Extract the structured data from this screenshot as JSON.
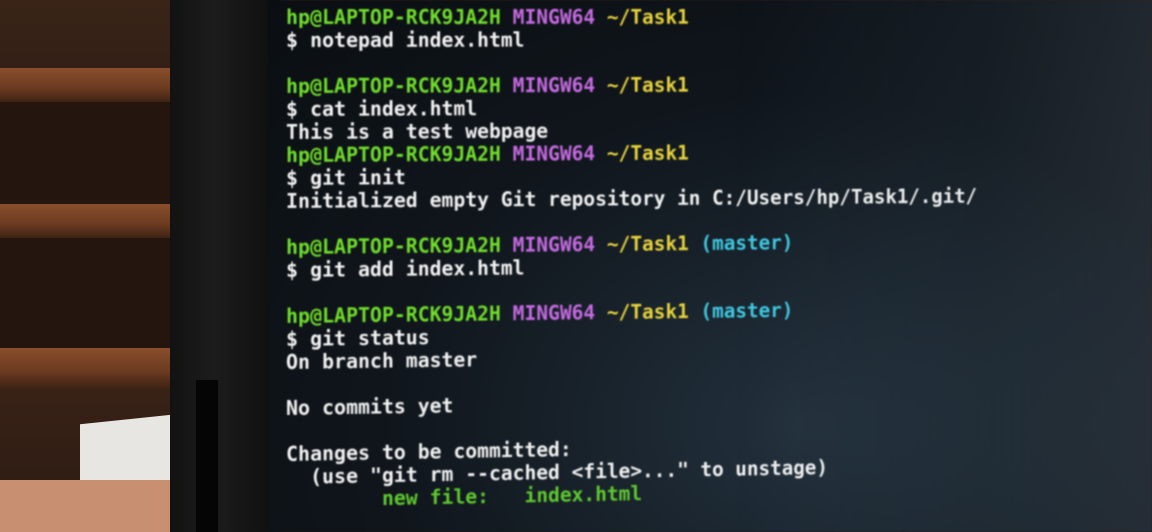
{
  "terminal": {
    "lines": [
      {
        "kind": "prompt",
        "user": "hp@LAPTOP-RCK9JA2H",
        "system": "MINGW64",
        "path": "~/Task1",
        "branch": ""
      },
      {
        "kind": "command",
        "text": "$ notepad index.html"
      },
      {
        "kind": "blank"
      },
      {
        "kind": "prompt",
        "user": "hp@LAPTOP-RCK9JA2H",
        "system": "MINGW64",
        "path": "~/Task1",
        "branch": ""
      },
      {
        "kind": "command",
        "text": "$ cat index.html"
      },
      {
        "kind": "output",
        "text": "This is a test webpage"
      },
      {
        "kind": "prompt",
        "user": "hp@LAPTOP-RCK9JA2H",
        "system": "MINGW64",
        "path": "~/Task1",
        "branch": ""
      },
      {
        "kind": "command",
        "text": "$ git init"
      },
      {
        "kind": "output",
        "text": "Initialized empty Git repository in C:/Users/hp/Task1/.git/"
      },
      {
        "kind": "blank"
      },
      {
        "kind": "prompt",
        "user": "hp@LAPTOP-RCK9JA2H",
        "system": "MINGW64",
        "path": "~/Task1",
        "branch": "(master)"
      },
      {
        "kind": "command",
        "text": "$ git add index.html"
      },
      {
        "kind": "blank"
      },
      {
        "kind": "prompt",
        "user": "hp@LAPTOP-RCK9JA2H",
        "system": "MINGW64",
        "path": "~/Task1",
        "branch": "(master)"
      },
      {
        "kind": "command",
        "text": "$ git status"
      },
      {
        "kind": "output",
        "text": "On branch master"
      },
      {
        "kind": "blank"
      },
      {
        "kind": "output",
        "text": "No commits yet"
      },
      {
        "kind": "blank"
      },
      {
        "kind": "output",
        "text": "Changes to be committed:"
      },
      {
        "kind": "output",
        "text": "  (use \"git rm --cached <file>...\" to unstage)"
      },
      {
        "kind": "newfile",
        "label": "        new file:",
        "file": "   index.html"
      }
    ]
  },
  "colors": {
    "user": "#6fdc2a",
    "system": "#c46ae0",
    "path": "#e6d23a",
    "branch": "#3ec8e0",
    "new_file": "#5ec82e",
    "text": "#f0f0f0"
  }
}
